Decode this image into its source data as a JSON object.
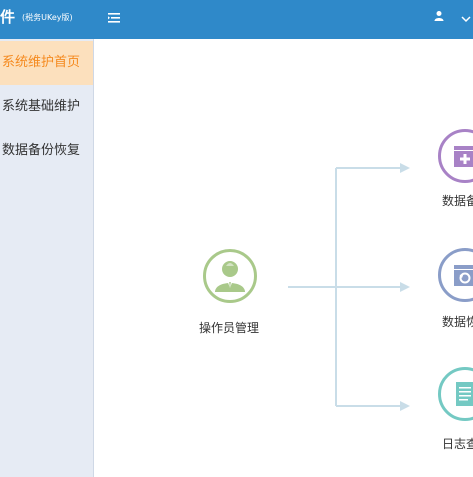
{
  "app": {
    "brand_title": "件",
    "brand_subtitle": "(税务UKey版)"
  },
  "sidebar": {
    "items": [
      {
        "label": "系统维护首页",
        "active": true
      },
      {
        "label": "系统基础维护",
        "active": false
      },
      {
        "label": "数据备份恢复",
        "active": false
      }
    ]
  },
  "header": {
    "menu_icon": "menu-toggle-icon",
    "user_icon": "user-icon",
    "dropdown_icon": "chevron-down-icon"
  },
  "flow": {
    "source": {
      "label": "操作员管理",
      "icon": "operator-icon",
      "color": "#a9c98a"
    },
    "targets": [
      {
        "label": "数据备",
        "icon": "database-add-icon",
        "color": "#a882c6"
      },
      {
        "label": "数据恢",
        "icon": "database-restore-icon",
        "color": "#8a9dc8"
      },
      {
        "label": "日志查",
        "icon": "log-icon",
        "color": "#74c9c3"
      }
    ]
  },
  "colors": {
    "header_bg": "#2f89c9",
    "sidebar_bg": "#e6ebf4",
    "active_bg": "#fce0bd",
    "active_text": "#f58a1f",
    "connector": "#c9dde8"
  }
}
